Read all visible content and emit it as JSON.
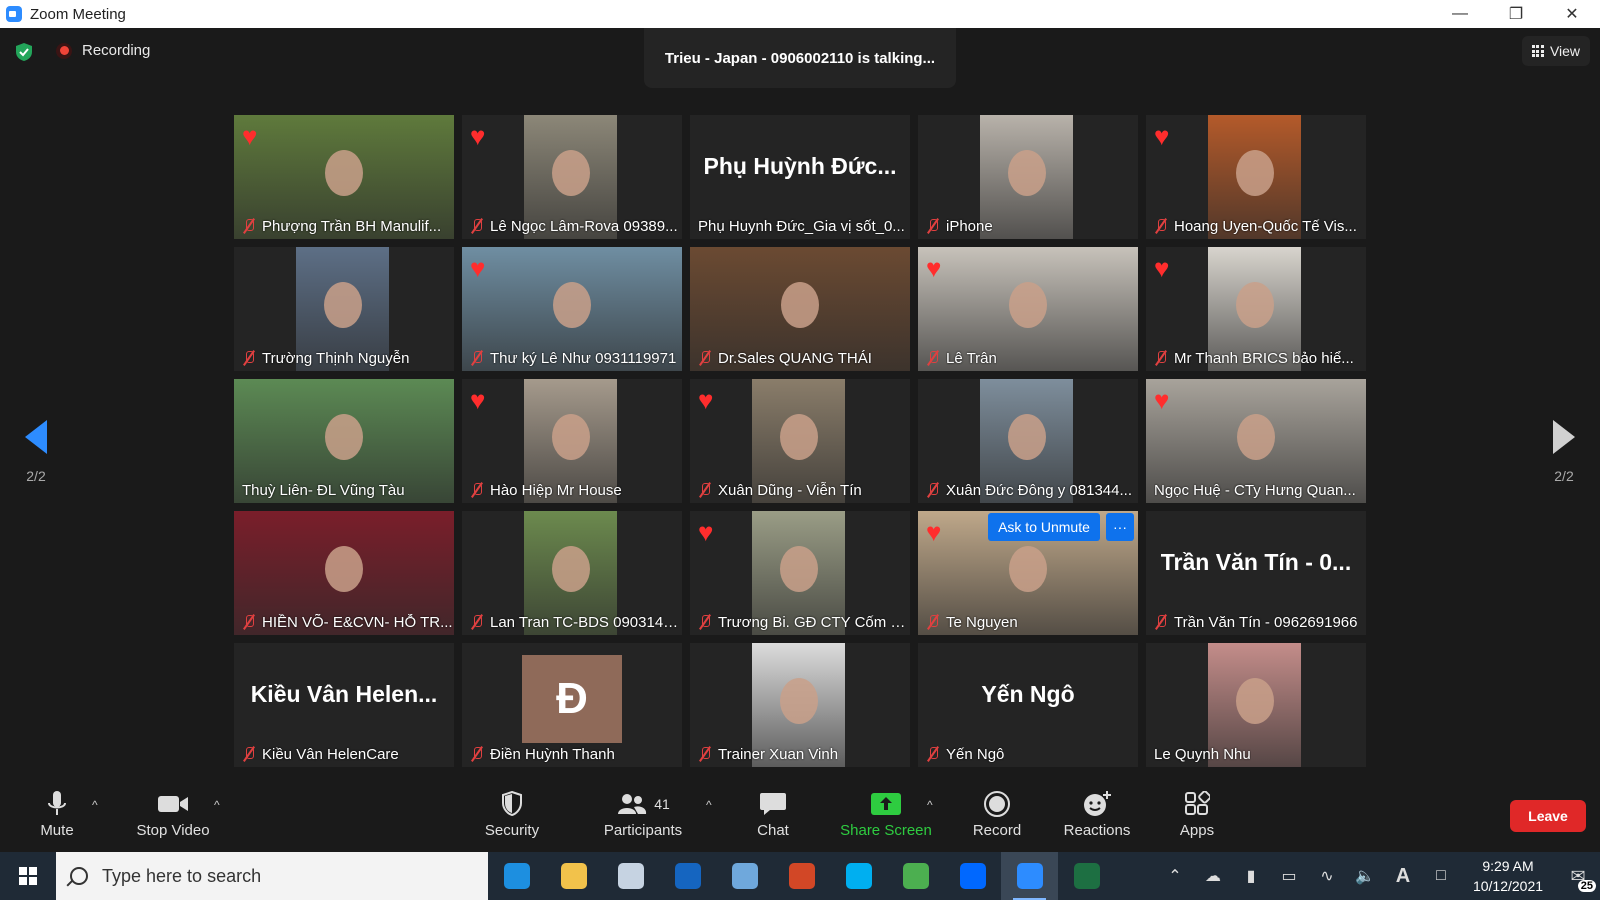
{
  "window": {
    "title": "Zoom Meeting"
  },
  "status": {
    "recording": "Recording",
    "talking": "Trieu - Japan - 0906002110 is talking...",
    "view": "View"
  },
  "pager": {
    "left": "2/2",
    "right": "2/2"
  },
  "tiles": [
    {
      "name": "Phượng Trần BH Manulif...",
      "muted": true,
      "heart": true,
      "video": "full",
      "bg": "#5f7a3c"
    },
    {
      "name": "Lê Ngọc Lâm-Rova 09389...",
      "muted": true,
      "heart": true,
      "video": "narrow",
      "bg": "#8c8778"
    },
    {
      "name": "Phụ Huynh Đức_Gia vị sốt_0...",
      "muted": false,
      "heart": false,
      "video": "none",
      "big": "Phụ Huỳnh Đức..."
    },
    {
      "name": "iPhone",
      "muted": true,
      "heart": false,
      "video": "narrow",
      "bg": "#b8b2aa"
    },
    {
      "name": "Hoang Uyen-Quốc Tế Vis...",
      "muted": true,
      "heart": true,
      "video": "narrow",
      "bg": "#b45a2a"
    },
    {
      "name": "Trường Thịnh Nguyễn",
      "muted": true,
      "heart": false,
      "video": "narrow",
      "bg": "#5d6f86"
    },
    {
      "name": "Thư ký Lê Như 0931119971",
      "muted": true,
      "heart": true,
      "video": "full",
      "bg": "#6f8ea2"
    },
    {
      "name": "Dr.Sales QUANG THÁI",
      "muted": true,
      "heart": false,
      "video": "full",
      "bg": "#6b4a32"
    },
    {
      "name": "Lê Trân",
      "muted": true,
      "heart": true,
      "video": "full",
      "bg": "#c7c2ba"
    },
    {
      "name": "Mr Thanh BRICS bảo hiể...",
      "muted": true,
      "heart": true,
      "video": "narrow",
      "bg": "#d8d4cd"
    },
    {
      "name": "Thuỳ Liên- ĐL Vũng Tàu",
      "muted": false,
      "heart": false,
      "video": "full",
      "bg": "#5c8a54"
    },
    {
      "name": "Hào Hiệp Mr House",
      "muted": true,
      "heart": true,
      "video": "narrow",
      "bg": "#a59a8c"
    },
    {
      "name": "Xuân Dũng - Viễn Tín",
      "muted": true,
      "heart": true,
      "video": "narrow",
      "bg": "#8a7d6a"
    },
    {
      "name": "Xuân Đức Đông y 081344...",
      "muted": true,
      "heart": false,
      "video": "narrow",
      "bg": "#7e8e9c"
    },
    {
      "name": "Ngọc Huệ - CTy Hưng Quan...",
      "muted": false,
      "heart": true,
      "video": "full",
      "bg": "#a8a39b"
    },
    {
      "name": "HIỀN VÕ- E&CVN- HỖ TR...",
      "muted": true,
      "heart": false,
      "video": "full",
      "bg": "#7a1e2a"
    },
    {
      "name": "Lan Tran TC-BDS 0903145...",
      "muted": true,
      "heart": false,
      "video": "narrow",
      "bg": "#6c8a4e"
    },
    {
      "name": "Trương Bi. GĐ CTY Cốm g...",
      "muted": true,
      "heart": true,
      "video": "narrow",
      "bg": "#9a9d86"
    },
    {
      "name": "Te Nguyen",
      "muted": true,
      "heart": true,
      "video": "full",
      "bg": "#bfa88a",
      "ask": "Ask to Unmute",
      "more": "···"
    },
    {
      "name": "Trần Văn Tín - 0962691966",
      "muted": true,
      "heart": false,
      "video": "none",
      "big": "Trần Văn Tín - 0..."
    },
    {
      "name": "Kiều Vân HelenCare",
      "muted": true,
      "heart": false,
      "video": "none",
      "big": "Kiều Vân Helen..."
    },
    {
      "name": "Điền Huỳnh Thanh",
      "muted": true,
      "heart": false,
      "video": "letter",
      "letter": "Đ"
    },
    {
      "name": "Trainer Xuan Vinh",
      "muted": true,
      "heart": false,
      "video": "narrow",
      "bg": "#dcdcdc"
    },
    {
      "name": "Yến Ngô",
      "muted": true,
      "heart": false,
      "video": "none",
      "big": "Yến Ngô"
    },
    {
      "name": "Le Quynh Nhu",
      "muted": false,
      "heart": false,
      "video": "narrow",
      "bg": "#c48d8a"
    }
  ],
  "toolbar": {
    "mute": "Mute",
    "stop_video": "Stop Video",
    "security": "Security",
    "participants": "Participants",
    "participants_count": "41",
    "chat": "Chat",
    "share": "Share Screen",
    "record": "Record",
    "reactions": "Reactions",
    "apps": "Apps",
    "leave": "Leave"
  },
  "taskbar": {
    "search_placeholder": "Type here to search",
    "time": "9:29 AM",
    "date": "10/12/2021",
    "notifications": "25",
    "apps": [
      {
        "name": "edge-icon",
        "color": "#1d8fe0"
      },
      {
        "name": "file-explorer-icon",
        "color": "#f2c24b"
      },
      {
        "name": "snipping-icon",
        "color": "#c6d3e2"
      },
      {
        "name": "outlook-icon",
        "color": "#1565c0"
      },
      {
        "name": "notes-icon",
        "color": "#6fa8dc"
      },
      {
        "name": "powerpoint-icon",
        "color": "#d24726"
      },
      {
        "name": "skype-icon",
        "color": "#00aff0"
      },
      {
        "name": "chrome-icon",
        "color": "#4caf50"
      },
      {
        "name": "zalo-icon",
        "color": "#0068ff"
      },
      {
        "name": "zoom-icon",
        "color": "#2d8cff"
      },
      {
        "name": "excel-icon",
        "color": "#1d6f42"
      }
    ]
  },
  "colors": {
    "accent": "#2d8cff",
    "share": "#2ecc40",
    "leave": "#e02828",
    "heart": "#ff2d2d"
  }
}
